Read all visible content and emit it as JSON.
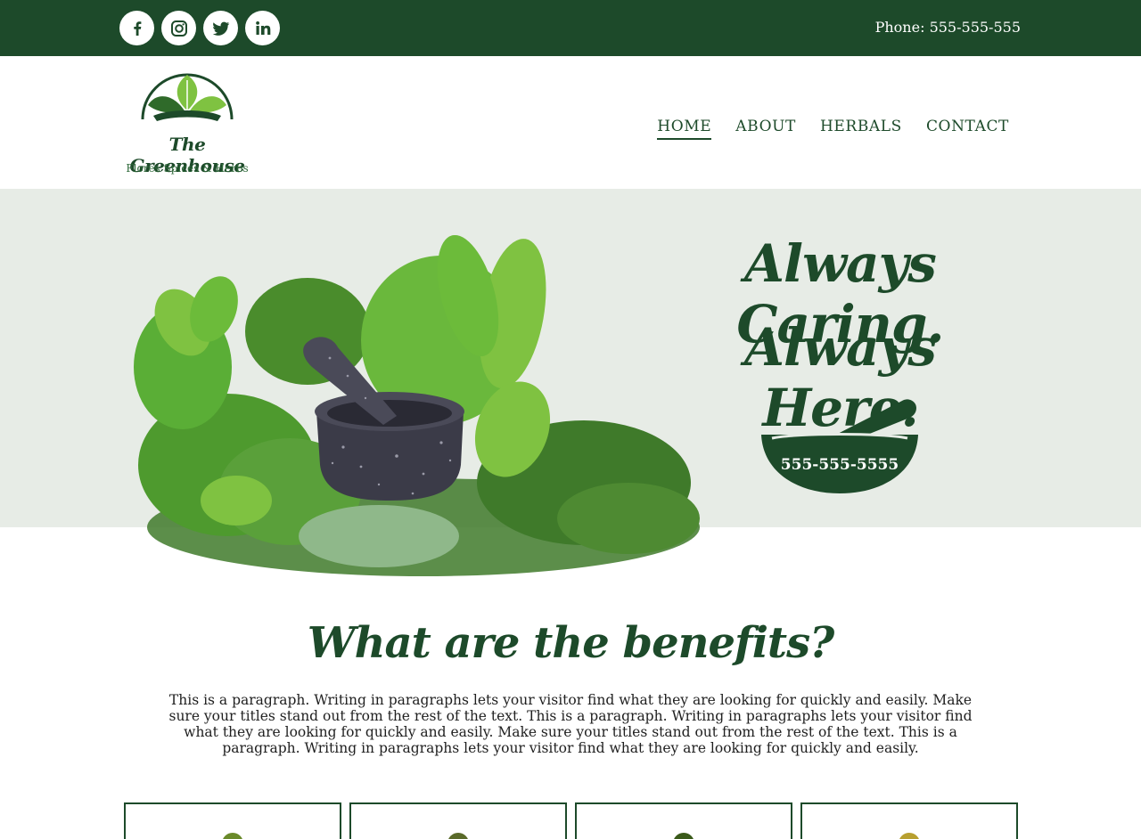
{
  "topbar": {
    "social": [
      {
        "name": "facebook-icon",
        "glyph": "f"
      },
      {
        "name": "instagram-icon",
        "glyph": ""
      },
      {
        "name": "twitter-icon",
        "glyph": ""
      },
      {
        "name": "linkedin-icon",
        "glyph": "in"
      }
    ],
    "phone_label": "Phone:",
    "phone_number": "555-555-555"
  },
  "logo": {
    "title": "The Greenhouse",
    "subtitle": "Flores Spices & Herbs"
  },
  "nav": {
    "items": [
      {
        "label": "HOME",
        "active": true
      },
      {
        "label": "ABOUT",
        "active": false
      },
      {
        "label": "HERBALS",
        "active": false
      },
      {
        "label": "CONTACT",
        "active": false
      }
    ]
  },
  "hero": {
    "tagline_1": "Always Caring.",
    "tagline_2": "Always Here.",
    "bowl_phone": "555-555-5555"
  },
  "benefits": {
    "title": "What are the benefits?",
    "text": "This is a paragraph. Writing in paragraphs lets your visitor find what they are looking for quickly and easily. Make sure your titles stand out from the rest of the text. This is a paragraph. Writing in paragraphs lets your visitor find what they are looking for quickly and easily. Make sure your titles stand out from the rest of the text. This is a paragraph. Writing in paragraphs lets your visitor find what they are looking for quickly and easily."
  },
  "colors": {
    "brand_green": "#1d4a2a",
    "hero_bg": "#e7ece6",
    "leaf_light": "#7fc241",
    "leaf_mid": "#4e9a2e"
  },
  "cards": [
    {
      "thumb_color": "#6a8a2a"
    },
    {
      "thumb_color": "#5a6a2a"
    },
    {
      "thumb_color": "#3a5a1a"
    },
    {
      "thumb_color": "#b8a030"
    }
  ]
}
